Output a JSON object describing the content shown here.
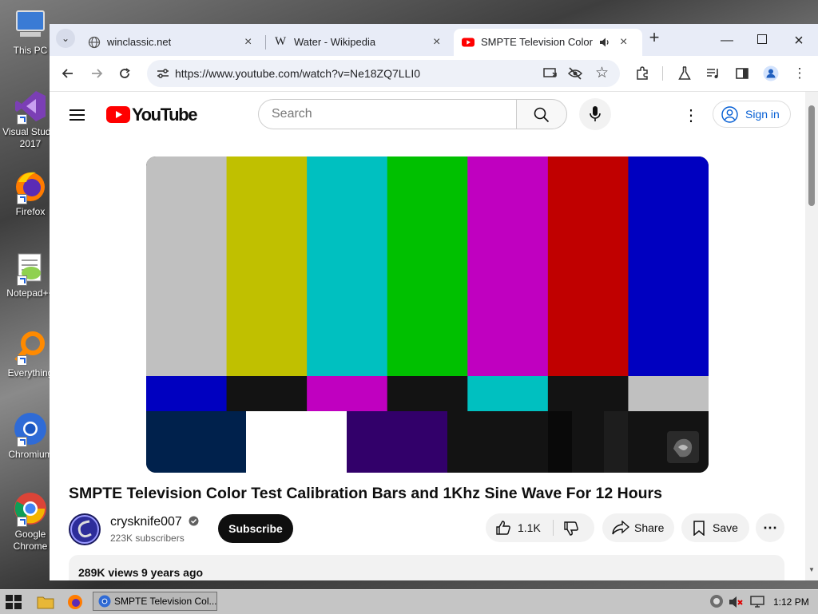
{
  "desktop": {
    "icons": [
      {
        "label_1": "This PC",
        "label_2": "",
        "icon": "computer-icon"
      },
      {
        "label_1": "Visual Studio",
        "label_2": "2017",
        "icon": "visual-studio-icon"
      },
      {
        "label_1": "Firefox",
        "label_2": "",
        "icon": "firefox-icon"
      },
      {
        "label_1": "Notepad++",
        "label_2": "",
        "icon": "notepadpp-icon"
      },
      {
        "label_1": "Everything",
        "label_2": "",
        "icon": "everything-search-icon"
      },
      {
        "label_1": "Chromium",
        "label_2": "",
        "icon": "chromium-icon"
      },
      {
        "label_1": "Google",
        "label_2": "Chrome",
        "icon": "chrome-icon"
      }
    ]
  },
  "browser": {
    "tabs": [
      {
        "title": "winclassic.net",
        "icon": "globe-icon"
      },
      {
        "title": "Water - Wikipedia",
        "icon": "wikipedia-icon"
      },
      {
        "title": "SMPTE Television Color Te",
        "icon": "youtube-icon"
      }
    ],
    "new_tab": "+",
    "url": "https://www.youtube.com/watch?v=Ne18ZQ7LLI0"
  },
  "youtube": {
    "logo_text": "YouTube",
    "search_placeholder": "Search",
    "sign_in": "Sign in",
    "video_title": "SMPTE Television Color Test Calibration Bars and 1Khz Sine Wave For 12 Hours",
    "channel_name": "crysknife007",
    "subscribers": "223K subscribers",
    "subscribe_label": "Subscribe",
    "likes": "1.1K",
    "share_label": "Share",
    "save_label": "Save",
    "views": "289K views",
    "age": "9 years ago",
    "colors": {
      "red": "#ff0000",
      "top_bars": [
        "#c0c0c0",
        "#c0c000",
        "#00c0c0",
        "#00c000",
        "#c000c0",
        "#c00000",
        "#0000c0"
      ],
      "mid_bars": [
        "#0000c0",
        "#131313",
        "#c000c0",
        "#131313",
        "#00c0c0",
        "#131313",
        "#c0c0c0"
      ],
      "bottom_bars": [
        "#00214c",
        "#ffffff",
        "#32006a",
        "#131313",
        "#090909",
        "#131313",
        "#1d1d1d",
        "#131313"
      ]
    }
  },
  "taskbar": {
    "app_label": "SMPTE Television Col...",
    "clock": "1:12 PM"
  }
}
